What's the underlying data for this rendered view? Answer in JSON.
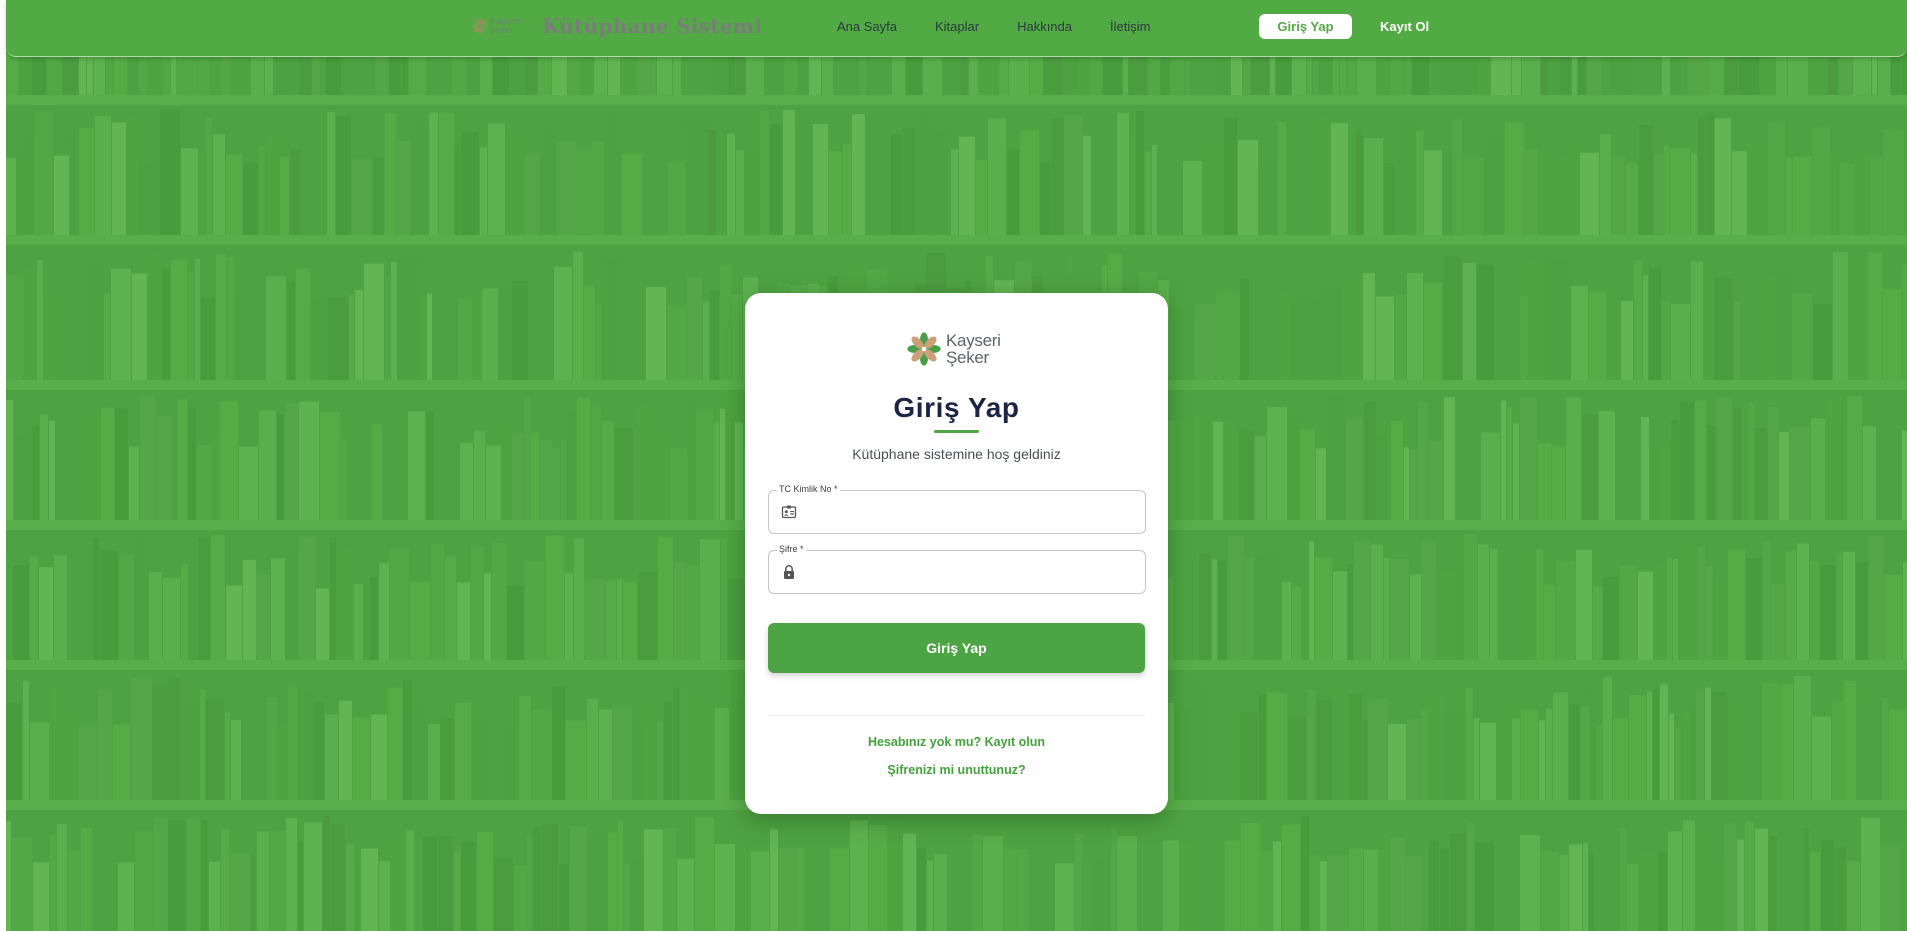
{
  "navbar": {
    "logo_line1": "Kayseri",
    "logo_line2": "Şeker",
    "title": "Kütüphane Sistemi",
    "links": [
      "Ana Sayfa",
      "Kitaplar",
      "Hakkında",
      "İletişim"
    ],
    "login_label": "Giriş Yap",
    "register_label": "Kayıt Ol"
  },
  "card": {
    "logo_line1": "Kayseri",
    "logo_line2": "Şeker",
    "title": "Giriş Yap",
    "subtitle": "Kütüphane sistemine hoş geldiniz",
    "tc_field": {
      "label": "TC Kimlik No *",
      "value": "",
      "placeholder": "",
      "icon": "id-card-icon"
    },
    "password_field": {
      "label": "Şifre *",
      "value": "",
      "placeholder": "",
      "icon": "lock-icon"
    },
    "submit_label": "Giriş Yap",
    "register_link": "Hesabınız yok mu? Kayıt olun",
    "forgot_link": "Şifrenizi mi unuttunuz?"
  },
  "colors": {
    "primary_green": "#4ca444",
    "navbar_green": "#52aa45",
    "title_navy": "#1c2544",
    "brand_title_mauve": "#8b6c8f"
  }
}
